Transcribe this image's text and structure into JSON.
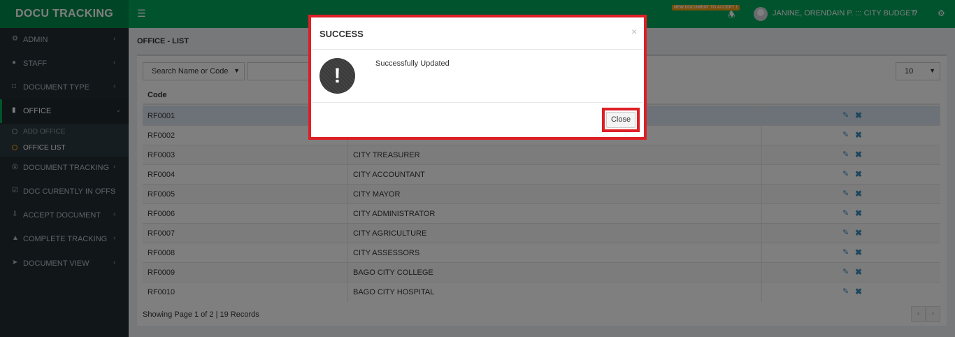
{
  "header": {
    "app_title": "DOCU TRACKING",
    "notification_badge": "NEW DOCUMENT TO ACCEPT 1",
    "user_name": "JANINE, ORENDAIN P. ::: CITY BUDGET",
    "help_label": "?"
  },
  "sidebar": {
    "items": [
      {
        "label": "ADMIN",
        "icon": "gear-icon"
      },
      {
        "label": "STAFF",
        "icon": "user-icon"
      },
      {
        "label": "DOCUMENT TYPE",
        "icon": "folder-icon"
      },
      {
        "label": "OFFICE",
        "icon": "building-icon"
      },
      {
        "label": "DOCUMENT TRACKING",
        "icon": "target-icon"
      },
      {
        "label": "DOC CURENTLY IN OFFS",
        "icon": "check-square-icon"
      },
      {
        "label": "ACCEPT DOCUMENT",
        "icon": "download-icon"
      },
      {
        "label": "COMPLETE TRACKING",
        "icon": "thumbs-up-icon"
      },
      {
        "label": "DOCUMENT VIEW",
        "icon": "rocket-icon"
      }
    ],
    "office_submenu": [
      {
        "label": "ADD OFFICE"
      },
      {
        "label": "OFFICE LIST"
      }
    ]
  },
  "content": {
    "page_title": "OFFICE - LIST",
    "search_field_select": "Search Name or Code",
    "search_input_value": "",
    "page_size": "10",
    "columns": [
      "Code"
    ],
    "rows": [
      {
        "code": "RF0001",
        "name": ""
      },
      {
        "code": "RF0002",
        "name": ""
      },
      {
        "code": "RF0003",
        "name": "CITY TREASURER"
      },
      {
        "code": "RF0004",
        "name": "CITY ACCOUNTANT"
      },
      {
        "code": "RF0005",
        "name": "CITY MAYOR"
      },
      {
        "code": "RF0006",
        "name": "CITY ADMINISTRATOR"
      },
      {
        "code": "RF0007",
        "name": "CITY AGRICULTURE"
      },
      {
        "code": "RF0008",
        "name": "CITY ASSESSORS"
      },
      {
        "code": "RF0009",
        "name": "BAGO CITY COLLEGE"
      },
      {
        "code": "RF0010",
        "name": "BAGO CITY HOSPITAL"
      }
    ],
    "footer_info": "Showing Page 1 of 2 | 19 Records",
    "pager_prev": "‹",
    "pager_next": "›"
  },
  "modal": {
    "title": "SUCCESS",
    "close_x": "×",
    "icon_glyph": "!",
    "message": "Successfully Updated",
    "close_button": "Close"
  },
  "colors": {
    "header_green": "#00a65a",
    "logo_green": "#008d4c",
    "sidebar_dark": "#222d32",
    "highlight_red": "#dd1f26"
  }
}
